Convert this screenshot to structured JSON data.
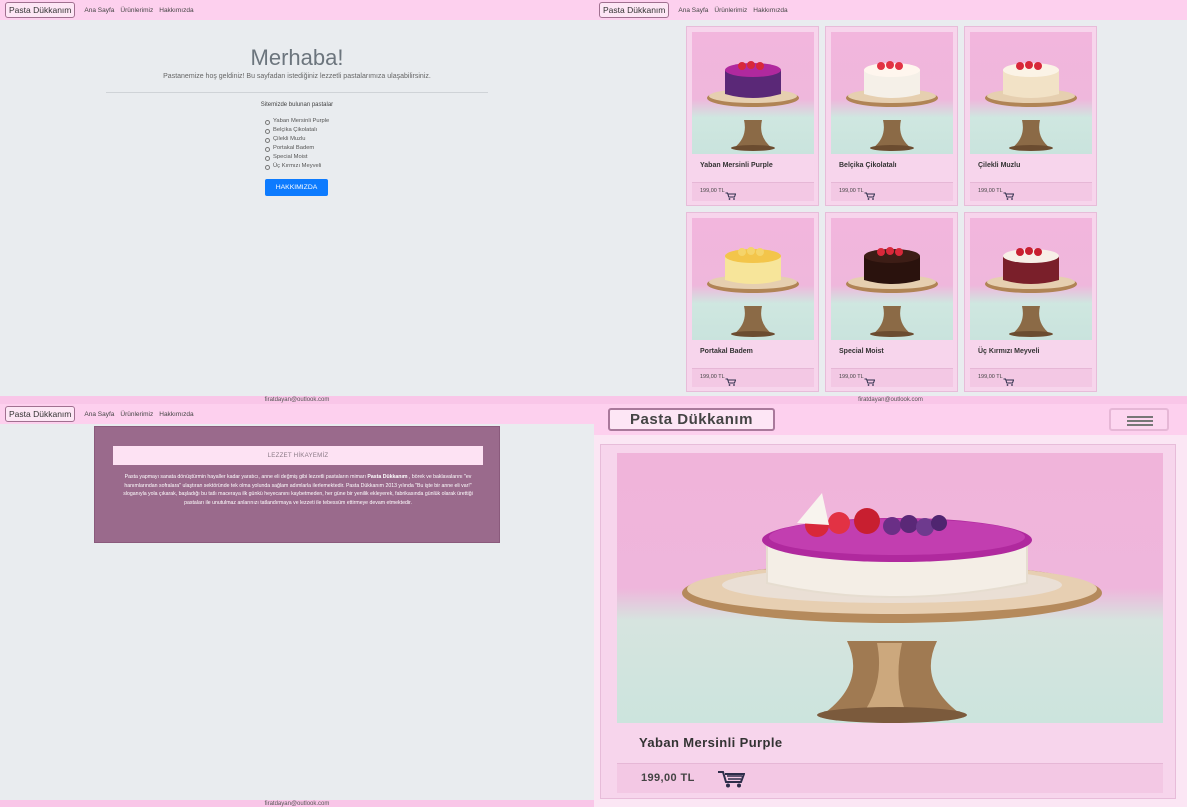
{
  "nav": {
    "brand": "Pasta Dükkanım",
    "links": [
      "Ana Sayfa",
      "Ürünlerimiz",
      "Hakkımızda"
    ]
  },
  "footer": {
    "email": "firatdayan@outlook.com"
  },
  "home": {
    "title": "Merhaba!",
    "lead": "Pastanemize hoş geldiniz! Bu sayfadan istediğiniz lezzetli pastalarımıza ulaşabilirsiniz.",
    "list_title": "Sitemizde bulunan pastalar",
    "cakes": [
      "Yaban Mersinli Purple",
      "Belçika Çikolatalı",
      "Çilekli Muzlu",
      "Portakal Badem",
      "Special Moist",
      "Üç Kırmızı Meyveli"
    ],
    "button": "HAKKIMIZDA"
  },
  "products": [
    {
      "name": "Yaban Mersinli Purple",
      "price": "199,00 TL",
      "icon": "cart-icon"
    },
    {
      "name": "Belçika Çikolatalı",
      "price": "199,00 TL",
      "icon": "cart-icon"
    },
    {
      "name": "Çilekli Muzlu",
      "price": "199,00 TL",
      "icon": "cart-icon"
    },
    {
      "name": "Portakal Badem",
      "price": "199,00 TL",
      "icon": "cart-icon"
    },
    {
      "name": "Special Moist",
      "price": "199,00 TL",
      "icon": "cart-icon"
    },
    {
      "name": "Üç Kırmızı Meyveli",
      "price": "199,00 TL",
      "icon": "cart-icon"
    }
  ],
  "about": {
    "heading": "LEZZET HİKAYEMİZ",
    "text_before": "Pasta yapmayı sanata dönüştürmin hayaller kadar yaratıcı, anne eli değmiş gibi lezzetli pastaların mimarı ",
    "text_bold": "Pasta Dükkanım",
    "text_after": " , börek ve baklavalarını \"ev hanımlarından sofralara\" ulaştıran sektöründe tek olma yolunda sağlam adımlarla ilerlemektedir. Pasta Dükkanım 2013 yılında \"Bu işte bir anne eli var!\" sloganıyla yola çıkarak, başladığı bu tatlı maceraya ilk günkü heyecanını kaybetmeden, her güne bir yenilik ekleyerek, fabrikasında günlük olarak ürettiği pastaları ile unutulmaz anlarınızı tatlandırmaya ve lezzeti ile tebessüm ettirmeye devam etmektedir."
  },
  "detail": {
    "brand": "Pasta Dükkanım",
    "name": "Yaban Mersinli Purple",
    "price": "199,00 TL",
    "menu_icon": "hamburger-menu-icon",
    "cart_icon": "cart-icon"
  },
  "colors": {
    "navbar": "#fdd0ee",
    "card": "#f7d5ec",
    "primary_button": "#0d7bfe",
    "story_bg": "#9a6a8c"
  },
  "cake_toppings": [
    "blueberry-purple",
    "chocolate",
    "strawberry",
    "orange-almond",
    "chocolate-berry",
    "three-red-fruit"
  ]
}
